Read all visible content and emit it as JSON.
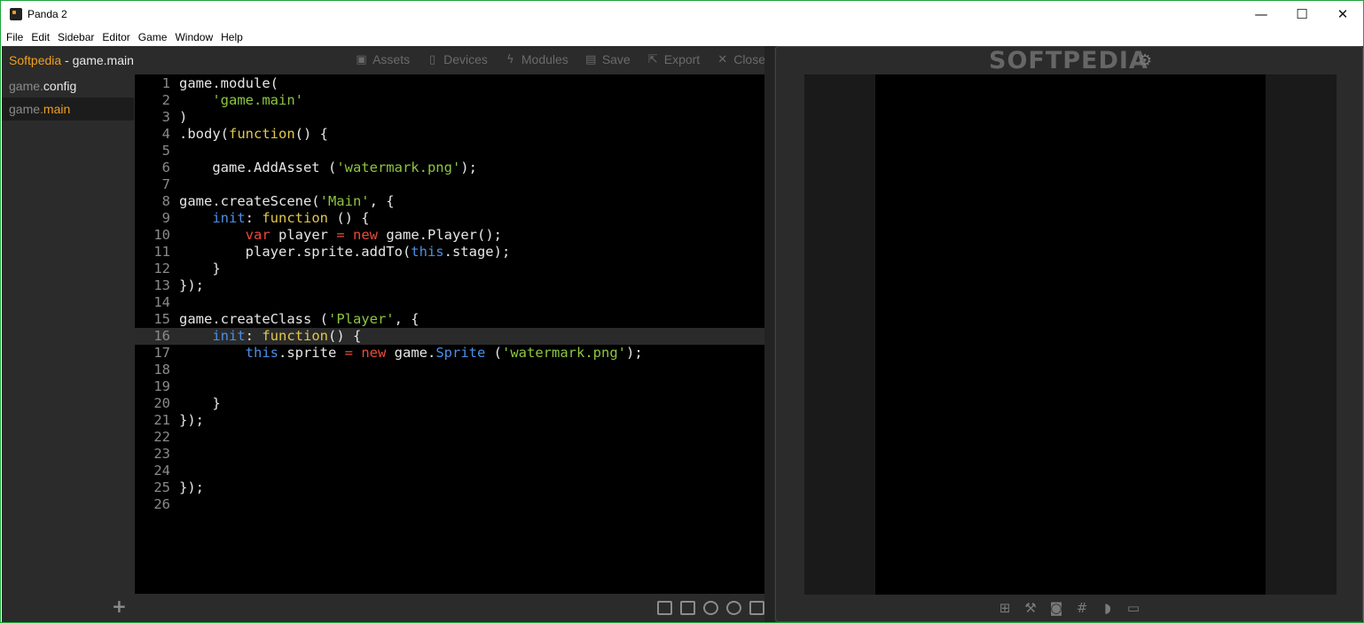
{
  "window": {
    "title": "Panda 2",
    "minimize": "—",
    "maximize": "☐",
    "close": "✕"
  },
  "menu": [
    "File",
    "Edit",
    "Sidebar",
    "Editor",
    "Game",
    "Window",
    "Help"
  ],
  "header": {
    "brand": "Softpedia",
    "separator": " - ",
    "document": "game.main"
  },
  "toolbar": [
    {
      "label": "Assets",
      "icon": "image-icon"
    },
    {
      "label": "Devices",
      "icon": "device-icon"
    },
    {
      "label": "Modules",
      "icon": "bolt-icon"
    },
    {
      "label": "Save",
      "icon": "save-icon"
    },
    {
      "label": "Export",
      "icon": "export-icon"
    },
    {
      "label": "Close",
      "icon": "close-icon"
    }
  ],
  "sidebar": {
    "items": [
      {
        "prefix": "game.",
        "name": "config",
        "active": false
      },
      {
        "prefix": "game.",
        "name": "main",
        "active": true
      }
    ],
    "add_label": "+"
  },
  "code": {
    "current_line": 16,
    "lines": [
      {
        "n": "1",
        "t": "game.module("
      },
      {
        "n": "2",
        "t": "    'game.main'"
      },
      {
        "n": "3",
        "t": ")"
      },
      {
        "n": "4",
        "t": ".body(function() {"
      },
      {
        "n": "5",
        "t": ""
      },
      {
        "n": "6",
        "t": "    game.AddAsset ('watermark.png');"
      },
      {
        "n": "7",
        "t": ""
      },
      {
        "n": "8",
        "t": "game.createScene('Main', {"
      },
      {
        "n": "9",
        "t": "    init: function () {"
      },
      {
        "n": "10",
        "t": "        var player = new game.Player();"
      },
      {
        "n": "11",
        "t": "        player.sprite.addTo(this.stage);"
      },
      {
        "n": "12",
        "t": "    }"
      },
      {
        "n": "13",
        "t": "});"
      },
      {
        "n": "14",
        "t": ""
      },
      {
        "n": "15",
        "t": "game.createClass ('Player', {"
      },
      {
        "n": "16",
        "t": "    init: function() {"
      },
      {
        "n": "17",
        "t": "        this.sprite = new game.Sprite ('watermark.png');"
      },
      {
        "n": "18",
        "t": ""
      },
      {
        "n": "19",
        "t": ""
      },
      {
        "n": "20",
        "t": "    }"
      },
      {
        "n": "21",
        "t": "});"
      },
      {
        "n": "22",
        "t": ""
      },
      {
        "n": "23",
        "t": ""
      },
      {
        "n": "24",
        "t": ""
      },
      {
        "n": "25",
        "t": "});"
      },
      {
        "n": "26",
        "t": ""
      }
    ]
  },
  "preview": {
    "watermark": "SOFTPEDIA",
    "settings_icon": "gear-icon",
    "bottom_icons": [
      "grid-icon",
      "ruler-icon",
      "camera-icon",
      "hash-icon",
      "mouse-icon",
      "monitor-icon"
    ]
  },
  "editor_status_icons": [
    "panel-left-icon",
    "image-icon",
    "zoom-out-icon",
    "zoom-in-icon",
    "panel-right-icon"
  ]
}
